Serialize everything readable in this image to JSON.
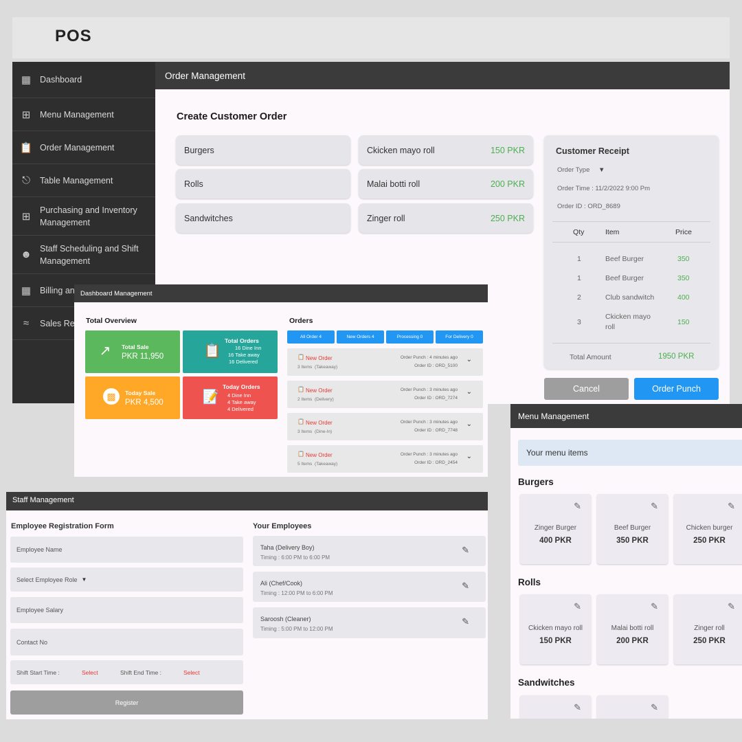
{
  "app": {
    "title": "POS"
  },
  "sidebar": {
    "items": [
      {
        "label": "Dashboard",
        "icon": "dashboard-icon"
      },
      {
        "label": "Menu Management",
        "icon": "grid-icon"
      },
      {
        "label": "Order Management",
        "icon": "clipboard-icon"
      },
      {
        "label": "Table Management",
        "icon": "table-icon"
      },
      {
        "label": "Purchasing and Inventory Management",
        "icon": "plus-box-icon"
      },
      {
        "label": "Staff Scheduling and Shift Management",
        "icon": "people-icon"
      },
      {
        "label": "Billing an",
        "icon": "billing-icon"
      },
      {
        "label": "Sales Re",
        "icon": "trend-icon"
      }
    ]
  },
  "order_management": {
    "header": "Order Management",
    "section_title": "Create Customer Order",
    "categories": [
      "Burgers",
      "Rolls",
      "Sandwitches"
    ],
    "menu_items": [
      {
        "name": "Ckicken mayo roll",
        "price": "150 PKR"
      },
      {
        "name": "Malai botti roll",
        "price": "200 PKR"
      },
      {
        "name": "Zinger roll",
        "price": "250 PKR"
      }
    ],
    "receipt": {
      "title": "Customer Receipt",
      "order_type": "Order Type",
      "order_time": "Order Time : 11/2/2022  9:00 Pm",
      "order_id": "Order ID : ORD_8689",
      "col_qty": "Qty",
      "col_item": "Item",
      "col_price": "Price",
      "rows": [
        {
          "qty": "1",
          "item": "Beef Burger",
          "price": "350"
        },
        {
          "qty": "1",
          "item": "Beef Burger",
          "price": "350"
        },
        {
          "qty": "2",
          "item": "Club sandwitch",
          "price": "400"
        },
        {
          "qty": "3",
          "item": "Ckicken mayo roll",
          "price": "150"
        }
      ],
      "total_label": "Total Amount",
      "total_value": "1950 PKR"
    },
    "cancel_label": "Cancel",
    "punch_label": "Order Punch"
  },
  "dashboard": {
    "header": "Dashboard Management",
    "overview_title": "Total Overview",
    "orders_title": "Orders",
    "cards": {
      "total_sale": {
        "title": "Total Sale",
        "value": "PKR 11,950",
        "color": "#5cb85c"
      },
      "total_orders": {
        "title": "Total Orders",
        "lines": [
          "16 Dine Inn",
          "16 Take away",
          "16 Delivered"
        ],
        "color": "#26a69a"
      },
      "today_sale": {
        "title": "Today Sale",
        "value": "PKR 4,500",
        "color": "#ffa726"
      },
      "today_orders": {
        "title": "Today Orders",
        "lines": [
          "4 Dine Inn",
          "4 Take away",
          "4 Delivered"
        ],
        "color": "#ef5350"
      }
    },
    "tabs": [
      "All Order 4",
      "New Orders 4",
      "Processing 0",
      "For Delivery 0"
    ],
    "orders": [
      {
        "status": "New Order",
        "items": "3 Items",
        "type": "(Takeaway)",
        "punch": "Order Punch : 4 minutes ago",
        "id": "Order ID : ORD_5100"
      },
      {
        "status": "New Order",
        "items": "2 Items",
        "type": "(Delivery)",
        "punch": "Order Punch : 3 minutes ago",
        "id": "Order ID : ORD_7274"
      },
      {
        "status": "New Order",
        "items": "3 Items",
        "type": "(Dine-In)",
        "punch": "Order Punch : 3 minutes ago",
        "id": "Order ID : ORD_7748"
      },
      {
        "status": "New Order",
        "items": "5 Items",
        "type": "(Takeaway)",
        "punch": "Order Punch : 3 minutes ago",
        "id": "Order ID : ORD_2454"
      }
    ]
  },
  "staff": {
    "header": "Staff Management",
    "form_title": "Employee Registration Form",
    "employees_title": "Your Employees",
    "fields": {
      "name": "Employee Name",
      "role": "Select Employee Role",
      "salary": "Employee Salary",
      "contact": "Contact No"
    },
    "shift_start_label": "Shift Start Time :",
    "shift_end_label": "Shift End Time :",
    "select_label": "Select",
    "register_label": "Register",
    "employees": [
      {
        "name": "Taha  (Delivery Boy)",
        "timing": "Timing : 6:00 PM to 6:00 PM"
      },
      {
        "name": "Ali  (Chef/Cook)",
        "timing": "Timing : 12:00 PM to 6:00 PM"
      },
      {
        "name": "Saroosh  (Cleaner)",
        "timing": "Timing : 5:00 PM to 12:00 PM"
      }
    ]
  },
  "menu_management": {
    "header": "Menu Management",
    "banner": "Your menu items",
    "categories": [
      {
        "name": "Burgers",
        "items": [
          {
            "name": "Zinger Burger",
            "price": "400 PKR"
          },
          {
            "name": "Beef Burger",
            "price": "350 PKR"
          },
          {
            "name": "Chicken burger",
            "price": "250 PKR"
          }
        ]
      },
      {
        "name": "Rolls",
        "items": [
          {
            "name": "Ckicken mayo roll",
            "price": "150 PKR"
          },
          {
            "name": "Malai botti roll",
            "price": "200 PKR"
          },
          {
            "name": "Zinger roll",
            "price": "250 PKR"
          }
        ]
      },
      {
        "name": "Sandwitches",
        "items": []
      }
    ]
  },
  "colors": {
    "accent_blue": "#2196f3",
    "price_green": "#4caf50",
    "header_dark": "#3b3b3b",
    "alert_red": "#e53935"
  }
}
